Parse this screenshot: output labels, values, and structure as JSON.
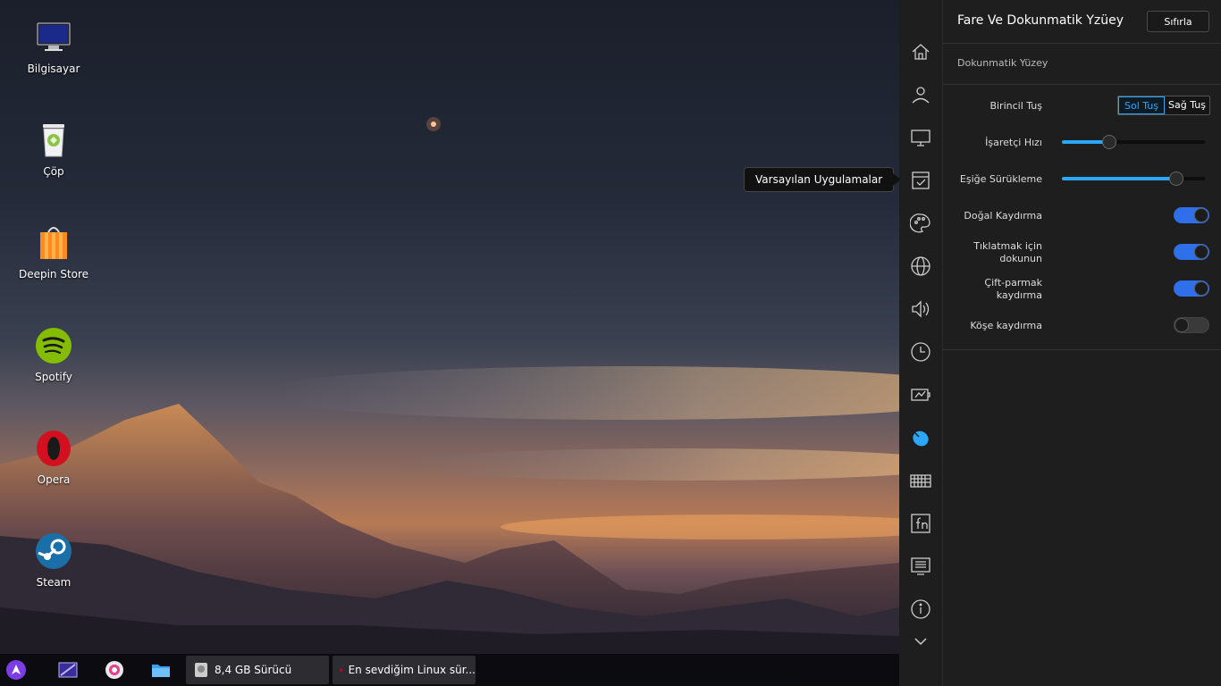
{
  "desktop": {
    "icons": [
      {
        "label": "Bilgisayar",
        "icon": "computer-icon"
      },
      {
        "label": "Çöp",
        "icon": "trash-icon"
      },
      {
        "label": "Deepin Store",
        "icon": "store-icon"
      },
      {
        "label": "Spotify",
        "icon": "spotify-icon"
      },
      {
        "label": "Opera",
        "icon": "opera-icon"
      },
      {
        "label": "Steam",
        "icon": "steam-icon"
      }
    ]
  },
  "tooltip": {
    "text": "Varsayılan Uygulamalar"
  },
  "taskbar": {
    "launchers": [
      "launcher-icon",
      "multitasking-icon",
      "settings-icon",
      "file-manager-icon"
    ],
    "tasks": [
      {
        "label": "8,4 GB Sürücü",
        "icon": "drive-icon"
      },
      {
        "label": "En sevdiğim Linux sür...",
        "icon": "opera-icon"
      }
    ]
  },
  "nav": {
    "items": [
      "home-icon",
      "account-icon",
      "display-icon",
      "default-apps-icon",
      "personalization-icon",
      "network-icon",
      "sound-icon",
      "time-icon",
      "power-icon",
      "mouse-icon",
      "keyboard-icon",
      "fn-icon",
      "system-info-icon",
      "info-icon",
      "chevron-down-icon"
    ],
    "active": "mouse-icon",
    "accent": "#2ca7f8"
  },
  "panel": {
    "title": "Fare Ve Dokunmatik Yzüey",
    "reset_label": "Sıfırla",
    "section": "Dokunmatik Yüzey",
    "primary_button": {
      "label": "Birincil Tuş",
      "options": [
        "Sol Tuş",
        "Sağ Tuş"
      ],
      "selected": "Sol Tuş"
    },
    "pointer_speed": {
      "label": "İşaretçi Hızı",
      "value": 0.33
    },
    "drag_threshold": {
      "label": "Eşiğe Sürükleme",
      "value": 0.8
    },
    "natural_scroll": {
      "label": "Doğal Kaydırma",
      "on": true
    },
    "tap_to_click": {
      "label1": "Tıklatmak için",
      "label2": "dokunun",
      "on": true
    },
    "two_finger": {
      "label1": "Çift-parmak",
      "label2": "kaydırma",
      "on": true
    },
    "edge_scroll": {
      "label": "Köşe kaydırma",
      "on": false
    }
  }
}
